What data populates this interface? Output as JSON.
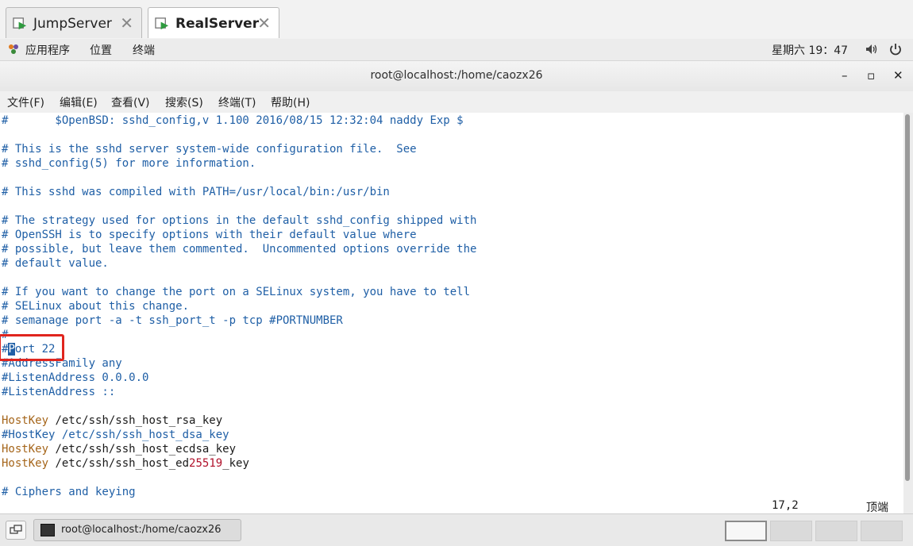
{
  "tabs": [
    {
      "label": "JumpServer",
      "active": false
    },
    {
      "label": "RealServer",
      "active": true
    }
  ],
  "gnome": {
    "menus": [
      "应用程序",
      "位置",
      "终端"
    ],
    "clock": "星期六 19：47",
    "icons": [
      "apps-icon",
      "volume-icon",
      "power-icon"
    ]
  },
  "window": {
    "title": "root@localhost:/home/caozx26",
    "controls": {
      "minimize": "–",
      "maximize": "▫",
      "close": "✕"
    }
  },
  "menubar": [
    "文件(F)",
    "编辑(E)",
    "查看(V)",
    "搜索(S)",
    "终端(T)",
    "帮助(H)"
  ],
  "terminal": {
    "lines": [
      "#\t$OpenBSD: sshd_config,v 1.100 2016/08/15 12:32:04 naddy Exp $",
      "",
      "# This is the sshd server system-wide configuration file.  See",
      "# sshd_config(5) for more information.",
      "",
      "# This sshd was compiled with PATH=/usr/local/bin:/usr/bin",
      "",
      "# The strategy used for options in the default sshd_config shipped with",
      "# OpenSSH is to specify options with their default value where",
      "# possible, but leave them commented.  Uncommented options override the",
      "# default value.",
      "",
      "# If you want to change the port on a SELinux system, you have to tell",
      "# SELinux about this change.",
      "# semanage port -a -t ssh_port_t -p tcp #PORTNUMBER",
      "#",
      "#Port 22",
      "#AddressFamily any",
      "#ListenAddress 0.0.0.0",
      "#ListenAddress ::",
      "",
      "HostKey /etc/ssh/ssh_host_rsa_key",
      "#HostKey /etc/ssh/ssh_host_dsa_key",
      "HostKey /etc/ssh/ssh_host_ecdsa_key",
      "HostKey /etc/ssh/ssh_host_ed25519_key",
      "",
      "# Ciphers and keying"
    ],
    "cursor_position": "17,2",
    "scroll_position": "顶端",
    "highlighted_line": "#Port 22"
  },
  "colors": {
    "comment": "#1f5fa6",
    "keyword": "#a5651a",
    "number": "#b0102a",
    "highlight_box": "#e0251e"
  },
  "taskbar": {
    "task_label": "root@localhost:/home/caozx26",
    "workspaces": 4,
    "active_workspace": 1
  }
}
